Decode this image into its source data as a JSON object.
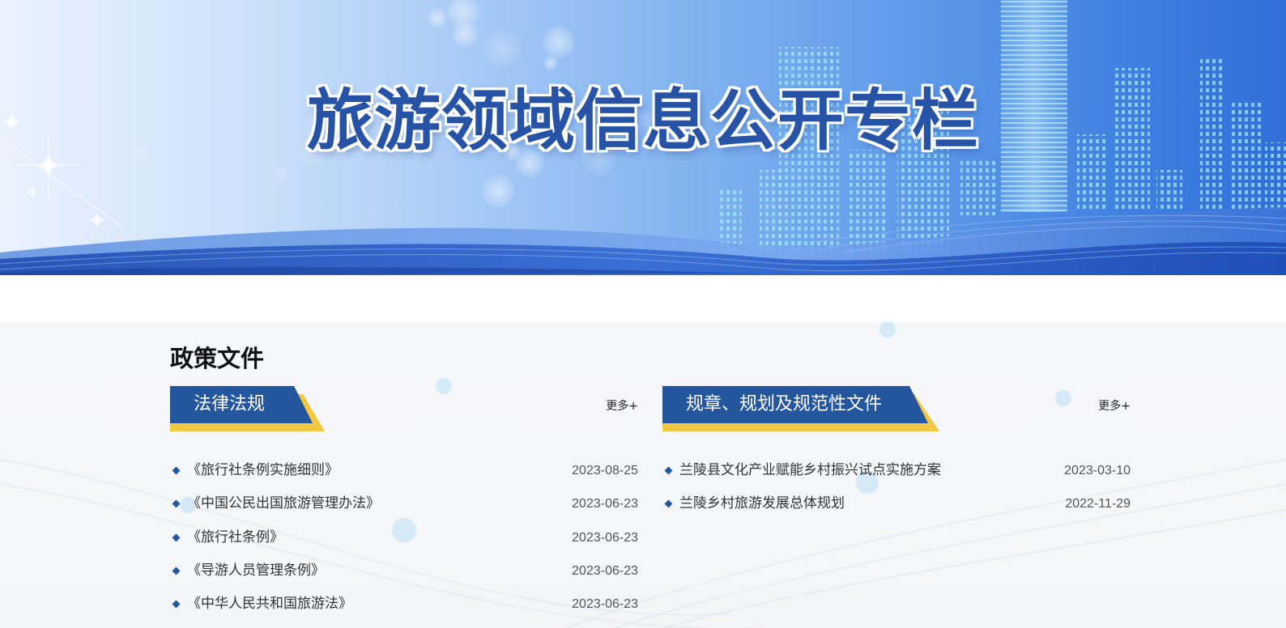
{
  "banner": {
    "title": "旅游领域信息公开专栏"
  },
  "section": {
    "heading": "政策文件"
  },
  "columns": [
    {
      "tab_label": "法律法规",
      "more_label": "更多+",
      "items": [
        {
          "title": "《旅行社条例实施细则》",
          "date": "2023-08-25"
        },
        {
          "title": "《中国公民出国旅游管理办法》",
          "date": "2023-06-23"
        },
        {
          "title": "《旅行社条例》",
          "date": "2023-06-23"
        },
        {
          "title": "《导游人员管理条例》",
          "date": "2023-06-23"
        },
        {
          "title": "《中华人民共和国旅游法》",
          "date": "2023-06-23"
        }
      ]
    },
    {
      "tab_label": "规章、规划及规范性文件",
      "more_label": "更多+",
      "items": [
        {
          "title": "兰陵县文化产业赋能乡村振兴试点实施方案",
          "date": "2023-03-10"
        },
        {
          "title": "兰陵乡村旅游发展总体规划",
          "date": "2022-11-29"
        }
      ]
    }
  ],
  "colors": {
    "accent_blue": "#24569e",
    "accent_yellow": "#f2c842",
    "title_blue": "#2753a6"
  }
}
